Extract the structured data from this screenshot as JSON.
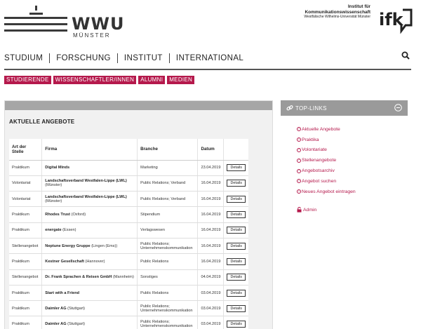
{
  "header": {
    "wwu_logo_text": "WWU",
    "wwu_logo_sub": "MÜNSTER",
    "ifk_line1": "Institut für",
    "ifk_line2": "Kommunikationswissenschaft",
    "ifk_line3": "Westfälische Wilhelms-Universität Münster",
    "ifk_mark": "ifk"
  },
  "mainnav": {
    "items": [
      "STUDIUM",
      "FORSCHUNG",
      "INSTITUT",
      "INTERNATIONAL"
    ]
  },
  "subnav": {
    "items": [
      "STUDIERENDE",
      "WISSENSCHAFTLER/INNEN",
      "ALUMNI",
      "MEDIEN"
    ]
  },
  "content": {
    "title": "AKTUELLE ANGEBOTE",
    "columns": [
      "Art der Stelle",
      "Firma",
      "Branche",
      "Datum",
      ""
    ],
    "rows": [
      {
        "art": "Praktikum",
        "firm": "Digital Minds",
        "loc": "",
        "branche": "Marketing",
        "datum": "23.04.2019",
        "btn": "Details"
      },
      {
        "art": "Volontariat",
        "firm": "Landschaftsverband Westfalen-Lippe (LWL)",
        "loc": "(Münster)",
        "branche": "Public Relations; Verband",
        "datum": "16.04.2019",
        "btn": "Details"
      },
      {
        "art": "Volontariat",
        "firm": "Landschaftsverband Westfalen-Lippe (LWL)",
        "loc": "(Münster)",
        "branche": "Public Relations; Verband",
        "datum": "16.04.2019",
        "btn": "Details"
      },
      {
        "art": "Praktikum",
        "firm": "Rhodes Trust",
        "loc": "(Oxford)",
        "branche": "Stipendium",
        "datum": "16.04.2019",
        "btn": "Details"
      },
      {
        "art": "Praktikum",
        "firm": "energate",
        "loc": "(Essen)",
        "branche": "Verlagswesen",
        "datum": "16.04.2019",
        "btn": "Details"
      },
      {
        "art": "Stellenangebot",
        "firm": "Neptune Energy Gruppe",
        "loc": "(Lingen (Ems))",
        "branche": "Public Relations; Unternehmenskommunikation",
        "datum": "16.04.2019",
        "btn": "Details"
      },
      {
        "art": "Praktikum",
        "firm": "Kestner Gesellschaft",
        "loc": "(Hannover)",
        "branche": "Public Relations",
        "datum": "16.04.2019",
        "btn": "Details"
      },
      {
        "art": "Stellenangebot",
        "firm": "Dr. Frank Sprachen & Reisen GmbH",
        "loc": "(Mannheim)",
        "branche": "Sonstiges",
        "datum": "04.04.2019",
        "btn": "Details"
      },
      {
        "art": "Praktikum",
        "firm": "Start with a Friend",
        "loc": "",
        "branche": "Public Relations",
        "datum": "03.04.2019",
        "btn": "Details"
      },
      {
        "art": "Praktikum",
        "firm": "Daimler AG",
        "loc": "(Stuttgart)",
        "branche": "Public Relations; Unternehmenskommunikation",
        "datum": "03.04.2019",
        "btn": "Details"
      },
      {
        "art": "Praktikum",
        "firm": "Daimler AG",
        "loc": "(Stuttgart)",
        "branche": "Public Relations; Unternehmenskommunikation",
        "datum": "03.04.2019",
        "btn": "Details"
      }
    ]
  },
  "sidebar": {
    "title": "TOP-LINKS",
    "links": [
      "Aktuelle Angebote",
      "Praktika",
      "Volontariate",
      "Stellenangebote",
      "Angebotsarchiv",
      "Angebot suchen",
      "Neues Angebot eintragen"
    ],
    "admin": "Admin"
  },
  "colors": {
    "accent": "#b5194c",
    "bar": "#a6a6a6",
    "sidebar_head": "#9a9a9a"
  }
}
